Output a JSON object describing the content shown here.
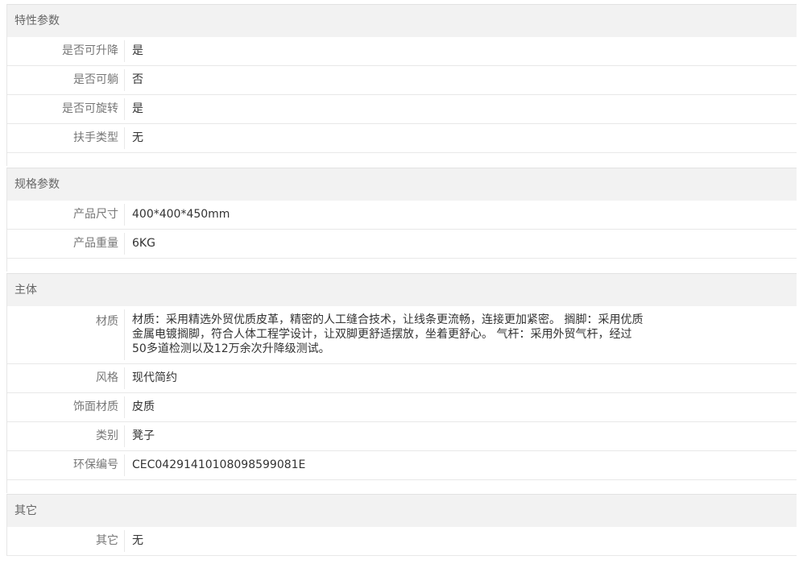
{
  "sections": [
    {
      "title": "特性参数",
      "rows": [
        {
          "label": "是否可升降",
          "value": "是"
        },
        {
          "label": "是否可躺",
          "value": "否"
        },
        {
          "label": "是否可旋转",
          "value": "是"
        },
        {
          "label": "扶手类型",
          "value": "无"
        }
      ]
    },
    {
      "title": "规格参数",
      "rows": [
        {
          "label": "产品尺寸",
          "value": "400*400*450mm"
        },
        {
          "label": "产品重量",
          "value": "6KG"
        }
      ]
    },
    {
      "title": "主体",
      "rows": [
        {
          "label": "材质",
          "value": "材质：采用精选外贸优质皮革，精密的人工缝合技术，让线条更流畅，连接更加紧密。 搁脚：采用优质金属电镀搁脚，符合人体工程学设计，让双脚更舒适摆放，坐着更舒心。 气杆：采用外贸气杆，经过50多道检测以及12万余次升降级测试。"
        },
        {
          "label": "风格",
          "value": "现代简约"
        },
        {
          "label": "饰面材质",
          "value": "皮质"
        },
        {
          "label": "类别",
          "value": "凳子"
        },
        {
          "label": "环保编号",
          "value": "CEC04291410108098599081E"
        }
      ]
    },
    {
      "title": "其它",
      "rows": [
        {
          "label": "其它",
          "value": "无"
        }
      ]
    }
  ]
}
